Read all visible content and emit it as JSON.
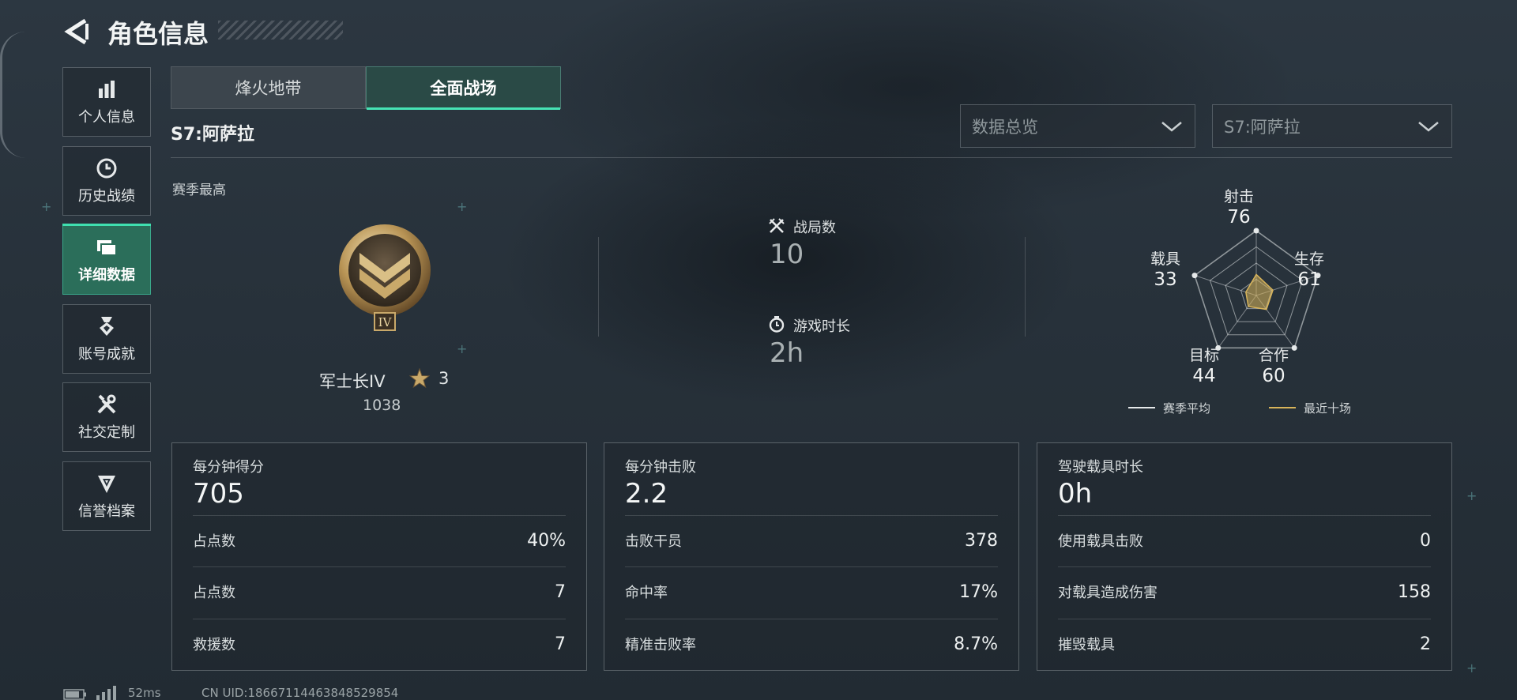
{
  "header": {
    "title": "角色信息"
  },
  "sidebar": {
    "items": [
      {
        "label": "个人信息",
        "icon": "bar-chart-icon"
      },
      {
        "label": "历史战绩",
        "icon": "clock-history-icon"
      },
      {
        "label": "详细数据",
        "icon": "folders-icon",
        "active": true
      },
      {
        "label": "账号成就",
        "icon": "medal-icon"
      },
      {
        "label": "社交定制",
        "icon": "tools-icon"
      },
      {
        "label": "信誉档案",
        "icon": "emblem-icon"
      }
    ]
  },
  "tabs": [
    {
      "label": "烽火地带",
      "active": false
    },
    {
      "label": "全面战场",
      "active": true
    }
  ],
  "season": "S7:阿萨拉",
  "filters": {
    "view": "数据总览",
    "season": "S7:阿萨拉"
  },
  "season_best": {
    "label": "赛季最高",
    "rank_name": "军士长IV",
    "rank_numeral": "IV",
    "stars": "3",
    "score": "1038"
  },
  "summary": {
    "matches_label": "战局数",
    "matches_value": "10",
    "playtime_label": "游戏时长",
    "playtime_value": "2h"
  },
  "radar": {
    "axes": [
      {
        "label": "射击",
        "value": 76
      },
      {
        "label": "生存",
        "value": 61
      },
      {
        "label": "合作",
        "value": 60
      },
      {
        "label": "目标",
        "value": 44
      },
      {
        "label": "载具",
        "value": 33
      }
    ],
    "legend": [
      {
        "label": "赛季平均",
        "color": "#e6e9ea"
      },
      {
        "label": "最近十场",
        "color": "#d8b45a"
      }
    ]
  },
  "cards": [
    {
      "title": "每分钟得分",
      "value": "705",
      "rows": [
        {
          "label": "占点数",
          "value": "40%"
        },
        {
          "label": "占点数",
          "value": "7"
        },
        {
          "label": "救援数",
          "value": "7"
        }
      ]
    },
    {
      "title": "每分钟击败",
      "value": "2.2",
      "rows": [
        {
          "label": "击败干员",
          "value": "378"
        },
        {
          "label": "命中率",
          "value": "17%"
        },
        {
          "label": "精准击败率",
          "value": "8.7%"
        }
      ]
    },
    {
      "title": "驾驶载具时长",
      "value": "0h",
      "rows": [
        {
          "label": "使用载具击败",
          "value": "0"
        },
        {
          "label": "对载具造成伤害",
          "value": "158"
        },
        {
          "label": "摧毁载具",
          "value": "2"
        }
      ]
    }
  ],
  "footer": {
    "ping": "52ms",
    "uid": "CN UID:18667114463848529854"
  },
  "colors": {
    "accent": "#46e3b4",
    "active_nav": "#2b6e5a",
    "recent_series": "#d8b45a"
  }
}
